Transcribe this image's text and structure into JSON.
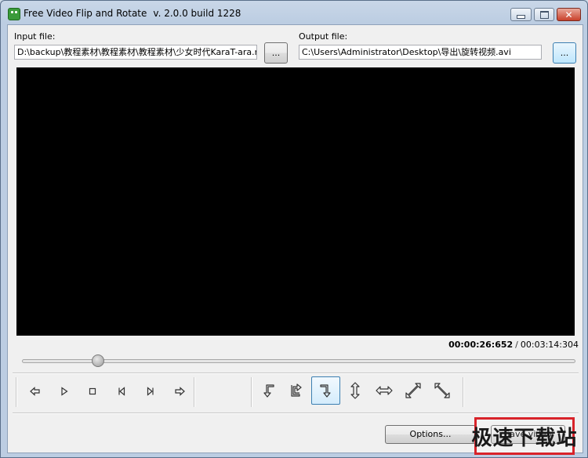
{
  "window": {
    "title": "Free Video Flip and Rotate",
    "version": "v. 2.0.0 build 1228"
  },
  "input": {
    "label": "Input file:",
    "value": "D:\\backup\\教程素材\\教程素材\\教程素材\\少女时代KaraT-ara.mp",
    "browse_label": "..."
  },
  "output": {
    "label": "Output file:",
    "value": "C:\\Users\\Administrator\\Desktop\\导出\\旋转视频.avi",
    "browse_label": "..."
  },
  "player": {
    "current_time": "00:00:26:652",
    "separator": "/",
    "total_time": "00:03:14:304",
    "position_fraction": 0.137
  },
  "playback_controls": [
    "step-back-icon",
    "play-icon",
    "stop-icon",
    "prev-frame-icon",
    "next-frame-icon",
    "step-forward-icon"
  ],
  "transform_controls": [
    "rotate-left-icon",
    "rotate-right-icon",
    "rotate-down-right-icon",
    "flip-vertical-icon",
    "flip-horizontal-icon",
    "diagonal-flip-icon",
    "anti-diagonal-flip-icon"
  ],
  "footer": {
    "options_label": "Options...",
    "save_label": "Save video"
  },
  "watermark": {
    "text": "极速下载站",
    "color": "#d8232a"
  }
}
